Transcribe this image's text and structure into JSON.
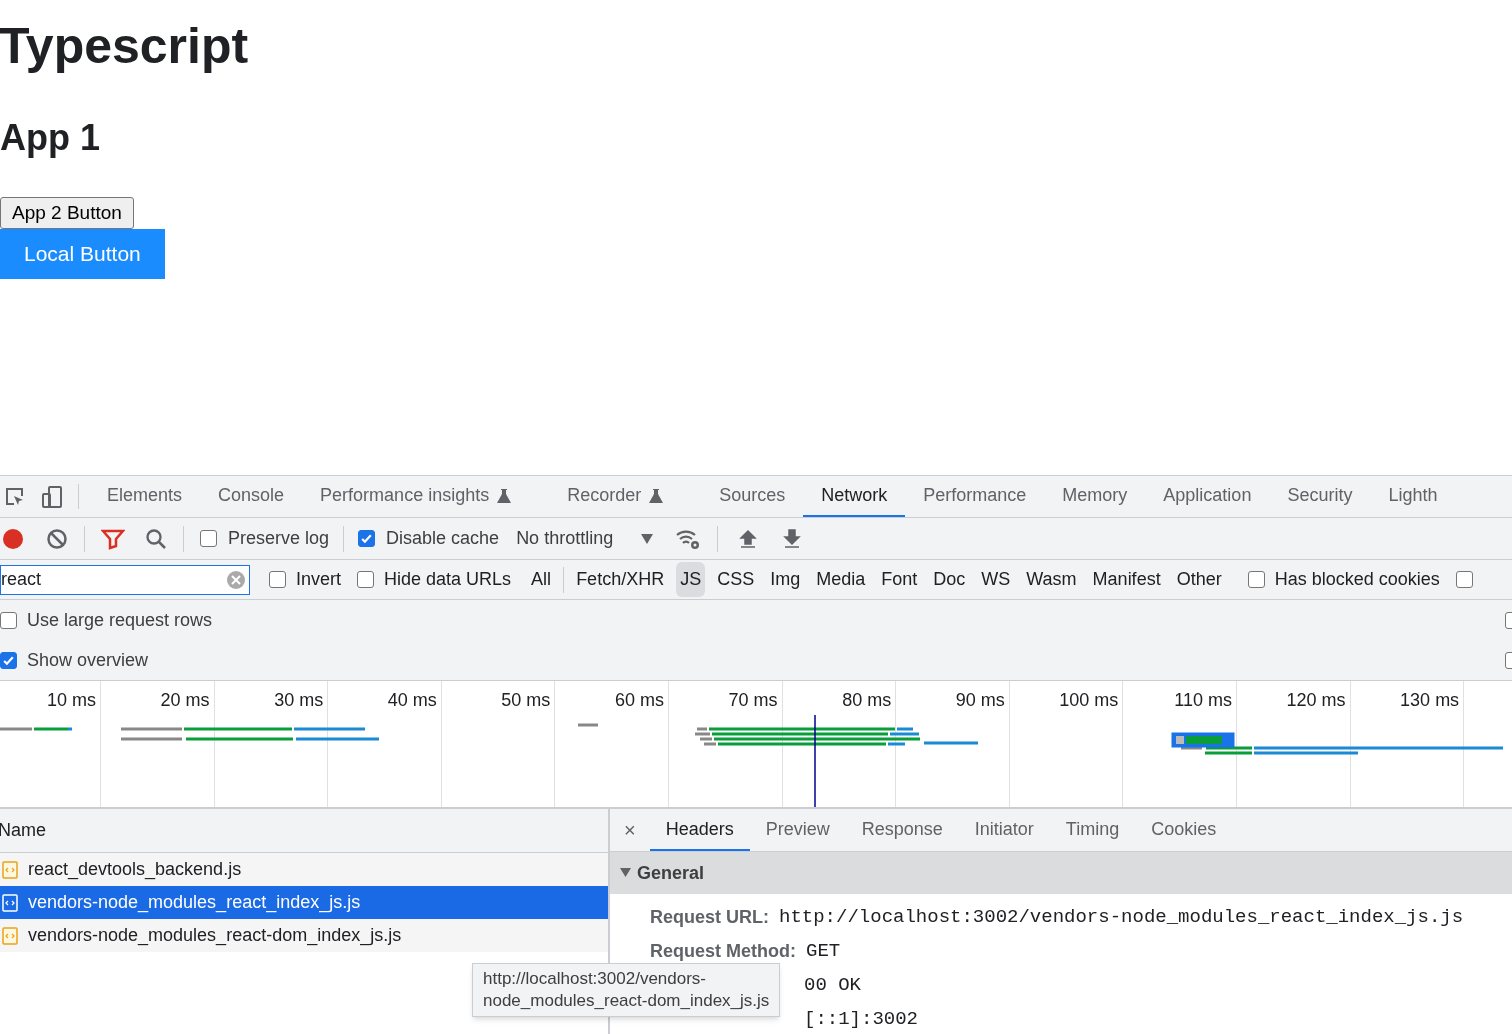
{
  "page": {
    "title": "Typescript",
    "subtitle": "App 1",
    "buttons": [
      {
        "label": "App 2 Button",
        "kind": "default"
      },
      {
        "label": "Local Button",
        "kind": "primary"
      }
    ]
  },
  "devtools": {
    "tabs": [
      {
        "label": "Elements",
        "selected": false,
        "experimental": false
      },
      {
        "label": "Console",
        "selected": false,
        "experimental": false
      },
      {
        "label": "Performance insights",
        "selected": false,
        "experimental": true
      },
      {
        "label": "Recorder",
        "selected": false,
        "experimental": true
      },
      {
        "label": "Sources",
        "selected": false,
        "experimental": false
      },
      {
        "label": "Network",
        "selected": true,
        "experimental": false
      },
      {
        "label": "Performance",
        "selected": false,
        "experimental": false
      },
      {
        "label": "Memory",
        "selected": false,
        "experimental": false
      },
      {
        "label": "Application",
        "selected": false,
        "experimental": false
      },
      {
        "label": "Security",
        "selected": false,
        "experimental": false
      },
      {
        "label": "Lighth",
        "selected": false,
        "experimental": false
      }
    ],
    "toolbar": {
      "recording": true,
      "checkboxes": [
        {
          "label": "Preserve log",
          "checked": false
        },
        {
          "label": "Disable cache",
          "checked": true
        }
      ],
      "throttling": "No throttling"
    },
    "filter": {
      "value": "react",
      "checkboxes": [
        {
          "label": "Invert",
          "checked": false
        },
        {
          "label": "Hide data URLs",
          "checked": false
        }
      ],
      "types": [
        {
          "label": "All",
          "selected": false
        },
        {
          "label": "Fetch/XHR",
          "selected": false
        },
        {
          "label": "JS",
          "selected": true
        },
        {
          "label": "CSS",
          "selected": false
        },
        {
          "label": "Img",
          "selected": false
        },
        {
          "label": "Media",
          "selected": false
        },
        {
          "label": "Font",
          "selected": false
        },
        {
          "label": "Doc",
          "selected": false
        },
        {
          "label": "WS",
          "selected": false
        },
        {
          "label": "Wasm",
          "selected": false
        },
        {
          "label": "Manifest",
          "selected": false
        },
        {
          "label": "Other",
          "selected": false
        }
      ],
      "trailing_checkboxes": [
        {
          "label": "Has blocked cookies",
          "checked": false
        },
        {
          "checked": false
        }
      ]
    },
    "options": [
      {
        "label": "Use large request rows",
        "checked": false,
        "right_checked": false
      },
      {
        "label": "Show overview",
        "checked": true,
        "right_checked": false
      }
    ],
    "overview": {
      "ticks": [
        "10 ms",
        "20 ms",
        "30 ms",
        "40 ms",
        "50 ms",
        "60 ms",
        "70 ms",
        "80 ms",
        "90 ms",
        "100 ms",
        "110 ms",
        "120 ms",
        "130 ms"
      ]
    },
    "requests": {
      "header": "Name",
      "rows": [
        {
          "name": "react_devtools_backend.js",
          "selected": false
        },
        {
          "name": "vendors-node_modules_react_index_js.js",
          "selected": true
        },
        {
          "name": "vendors-node_modules_react-dom_index_js.js",
          "selected": false
        }
      ]
    },
    "details": {
      "close": "×",
      "tabs": [
        {
          "label": "Headers",
          "selected": true
        },
        {
          "label": "Preview",
          "selected": false
        },
        {
          "label": "Response",
          "selected": false
        },
        {
          "label": "Initiator",
          "selected": false
        },
        {
          "label": "Timing",
          "selected": false
        },
        {
          "label": "Cookies",
          "selected": false
        }
      ],
      "section": {
        "title": "General",
        "expanded": true
      },
      "fields": [
        {
          "label": "Request URL:",
          "value": "http://localhost:3002/vendors-node_modules_react_index_js.js"
        },
        {
          "label": "Request Method:",
          "value": "GET"
        },
        {
          "value": "00 OK"
        },
        {
          "value": "[::1]:3002"
        }
      ]
    },
    "tooltip": {
      "lines": [
        "http://localhost:3002/vendors-",
        "node_modules_react-dom_index_js.js"
      ]
    }
  }
}
